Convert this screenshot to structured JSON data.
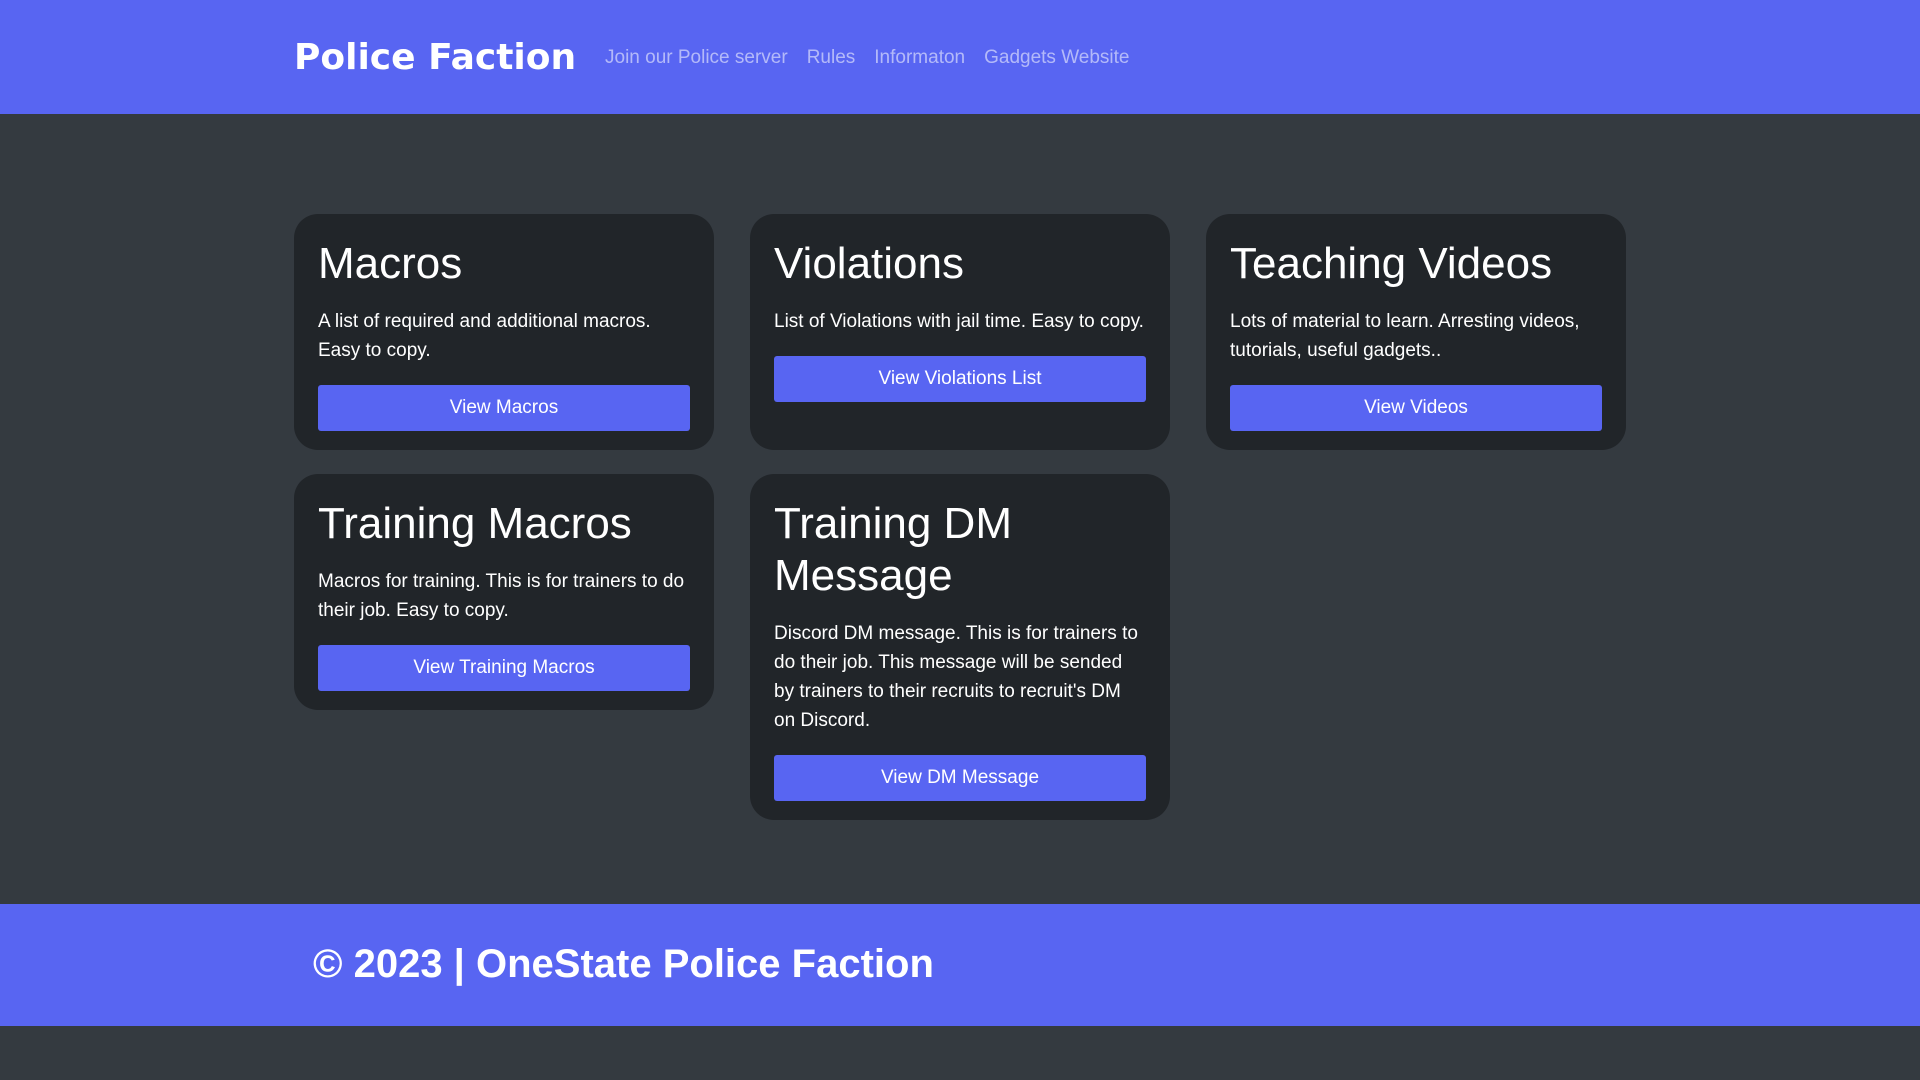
{
  "header": {
    "brand": "Police Faction",
    "nav": [
      {
        "label": "Join our Police server"
      },
      {
        "label": "Rules"
      },
      {
        "label": "Informaton"
      },
      {
        "label": "Gadgets Website"
      }
    ]
  },
  "cards": [
    {
      "title": "Macros",
      "text": "A list of required and additional macros. Easy to copy.",
      "button": "View Macros"
    },
    {
      "title": "Violations",
      "text": "List of Violations with jail time. Easy to copy.",
      "button": "View Violations List"
    },
    {
      "title": "Teaching Videos",
      "text": "Lots of material to learn. Arresting videos, tutorials, useful gadgets..",
      "button": "View Videos"
    },
    {
      "title": "Training Macros",
      "text": "Macros for training. This is for trainers to do their job. Easy to copy.",
      "button": "View Training Macros"
    },
    {
      "title": "Training DM Message",
      "text": "Discord DM message. This is for trainers to do their job. This message will be sended by trainers to their recruits to recruit's DM on Discord.",
      "button": "View DM Message"
    }
  ],
  "footer": {
    "text": "© 2023 | OneState Police Faction"
  },
  "colors": {
    "accent": "#5865f2",
    "background": "#343a40",
    "card": "#212529"
  }
}
